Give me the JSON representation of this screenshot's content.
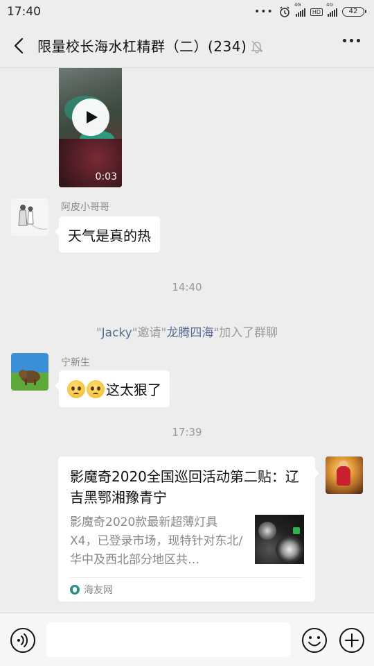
{
  "status_bar": {
    "time": "17:40",
    "network_1": "4G",
    "network_2": "4G",
    "hd": "HD",
    "battery": "42"
  },
  "header": {
    "title": "限量校长海水杠精群（二）(234)"
  },
  "messages": {
    "video": {
      "duration": "0:03"
    },
    "msg1": {
      "sender": "阿皮小哥哥",
      "text": "天气是真的热"
    },
    "time1": "14:40",
    "system": {
      "q1": "\"",
      "inviter": "Jacky",
      "q2": "\"邀请\"",
      "invitee": "龙腾四海",
      "q3": "\"加入了群聊"
    },
    "msg2": {
      "sender": "宁新生",
      "text": "这太狠了"
    },
    "time2": "17:39",
    "card": {
      "title": "影魔奇2020全国巡回活动第二贴：辽吉黑鄂湘豫青宁",
      "description": "影魔奇2020款最新超薄灯具X4，已登录市场，现特针对东北/华中及西北部分地区共…",
      "source": "海友网"
    }
  },
  "input": {
    "placeholder": ""
  }
}
